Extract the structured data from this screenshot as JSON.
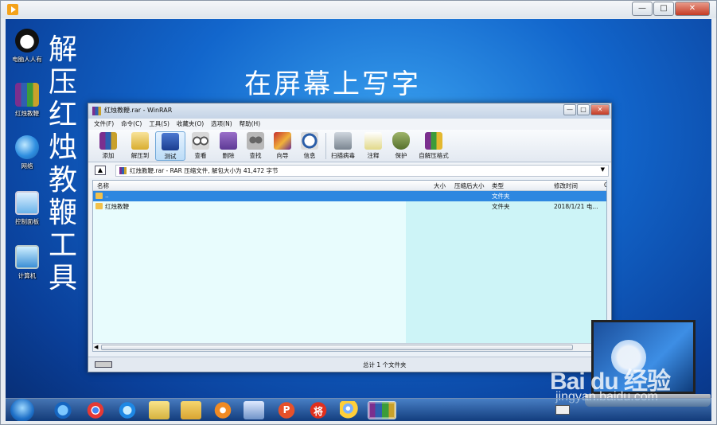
{
  "rar": {
    "title": "红烛教鞭.rar - WinRAR",
    "menu": [
      "文件(F)",
      "命令(C)",
      "工具(S)",
      "收藏夹(O)",
      "选项(N)",
      "帮助(H)"
    ],
    "toolbar": [
      "添加",
      "解压到",
      "测试",
      "查看",
      "删除",
      "查找",
      "向导",
      "信息",
      "扫描病毒",
      "注释",
      "保护",
      "自解压格式"
    ],
    "address": "红烛教鞭.rar - RAR 压缩文件, 解包大小为 41,472 字节",
    "columns": [
      "名称",
      "大小",
      "压缩后大小",
      "类型",
      "修改时间",
      "C"
    ],
    "rows": [
      {
        "name": "..",
        "type": "文件夹",
        "modified": ""
      },
      {
        "name": "红烛教鞭",
        "type": "文件夹",
        "modified": "2018/1/21 电..."
      }
    ],
    "status": "总计 1 个文件夹"
  },
  "desktop": {
    "icons": [
      "电脑人人有",
      "红烛教鞭",
      "网络",
      "控制面板",
      "计算机"
    ],
    "vertical_title": [
      "解",
      "压",
      "红",
      "烛",
      "教",
      "鞭",
      "工",
      "具"
    ],
    "headline": "在屏幕上写字"
  },
  "watermark": {
    "brand": "Bai du 经验",
    "site": "jingyan.baidu.com"
  },
  "taskbar": {
    "p_glyph": "P",
    "jiang_glyph": "将"
  }
}
